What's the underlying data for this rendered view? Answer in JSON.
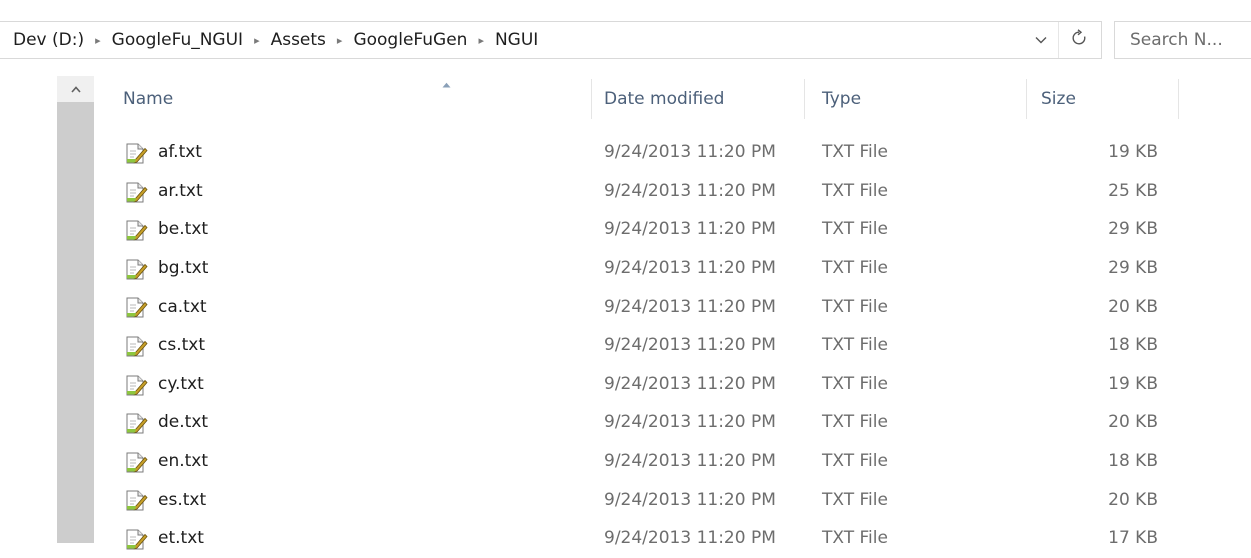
{
  "address_bar": {
    "crumbs": [
      "Dev (D:)",
      "GoogleFu_NGUI",
      "Assets",
      "GoogleFuGen",
      "NGUI"
    ],
    "separator": "▸",
    "dropdown_icon": "chevron-down-icon",
    "refresh_icon": "refresh-icon"
  },
  "search": {
    "placeholder": "Search N..."
  },
  "columns": {
    "name": "Name",
    "date_modified": "Date modified",
    "type": "Type",
    "size": "Size"
  },
  "scrollbar": {
    "up_arrow_icon": "arrow-up-icon"
  },
  "files": [
    {
      "name": "af.txt",
      "date": "9/24/2013 11:20 PM",
      "type": "TXT File",
      "size": "19 KB"
    },
    {
      "name": "ar.txt",
      "date": "9/24/2013 11:20 PM",
      "type": "TXT File",
      "size": "25 KB"
    },
    {
      "name": "be.txt",
      "date": "9/24/2013 11:20 PM",
      "type": "TXT File",
      "size": "29 KB"
    },
    {
      "name": "bg.txt",
      "date": "9/24/2013 11:20 PM",
      "type": "TXT File",
      "size": "29 KB"
    },
    {
      "name": "ca.txt",
      "date": "9/24/2013 11:20 PM",
      "type": "TXT File",
      "size": "20 KB"
    },
    {
      "name": "cs.txt",
      "date": "9/24/2013 11:20 PM",
      "type": "TXT File",
      "size": "18 KB"
    },
    {
      "name": "cy.txt",
      "date": "9/24/2013 11:20 PM",
      "type": "TXT File",
      "size": "19 KB"
    },
    {
      "name": "de.txt",
      "date": "9/24/2013 11:20 PM",
      "type": "TXT File",
      "size": "20 KB"
    },
    {
      "name": "en.txt",
      "date": "9/24/2013 11:20 PM",
      "type": "TXT File",
      "size": "18 KB"
    },
    {
      "name": "es.txt",
      "date": "9/24/2013 11:20 PM",
      "type": "TXT File",
      "size": "20 KB"
    },
    {
      "name": "et.txt",
      "date": "9/24/2013 11:20 PM",
      "type": "TXT File",
      "size": "17 KB"
    }
  ],
  "file_icon": "text-file-icon"
}
